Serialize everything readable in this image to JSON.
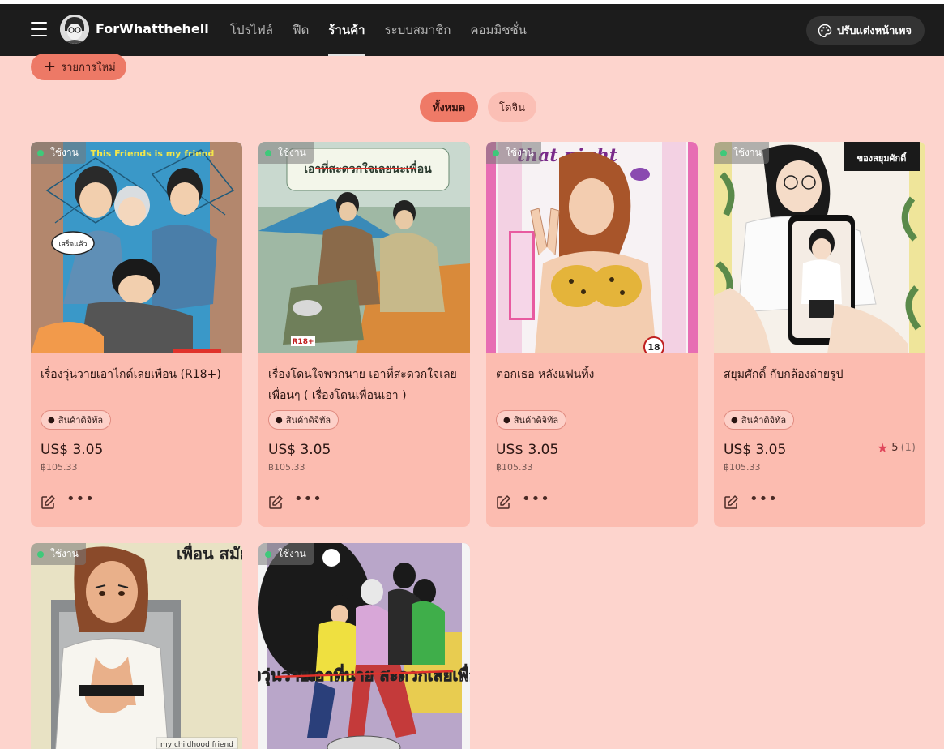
{
  "navbar": {
    "brand": "ForWhatthehell",
    "links": [
      {
        "label": "โปรไฟล์",
        "active": false
      },
      {
        "label": "ฟีด",
        "active": false
      },
      {
        "label": "ร้านค้า",
        "active": true
      },
      {
        "label": "ระบบสมาชิก",
        "active": false
      },
      {
        "label": "คอมมิชชั่น",
        "active": false
      }
    ],
    "customize_label": "ปรับแต่งหน้าเพจ"
  },
  "toolbar": {
    "new_item_label": "รายการใหม่"
  },
  "filters": {
    "all_label": "ทั้งหมด",
    "doujin_label": "โดจิน",
    "active": "all"
  },
  "status_label": "ใช้งาน",
  "tag_label": "สินค้าดิจิทัล",
  "products": [
    {
      "title": "เรื่องวุ่นวายเอาไกด์เลยเพื่อน (R18+)",
      "price_usd": "US$ 3.05",
      "price_thb": "฿105.33",
      "cover_text": "This Friends is my friend",
      "cover_bubble": "เสร็จแล้ว",
      "cover_color": "#3a98c8"
    },
    {
      "title": "เรื่องโดนใจพวกนาย เอาที่สะดวกใจเลยเพื่อนๆ ( เรื่องโดนเพื่อนเอา )",
      "price_usd": "US$ 3.05",
      "price_thb": "฿105.33",
      "cover_text": "เอาที่สะดวกใจเลยนะเพื่อน",
      "cover_sub": "R18+",
      "cover_color": "#7fb08c"
    },
    {
      "title": "ตอกเธอ หลังแฟนทิ้ง",
      "price_usd": "US$ 3.05",
      "price_thb": "฿105.33",
      "cover_text": "that night",
      "cover_sub": "18",
      "cover_color": "#e76db3"
    },
    {
      "title": "สยุมศักดิ์ กับกล้องถ่ายรูป",
      "price_usd": "US$ 3.05",
      "price_thb": "฿105.33",
      "cover_text": "ของสยุมศักดิ์",
      "cover_color": "#efe59a",
      "rating": "5",
      "rating_count": "(1)"
    }
  ],
  "products_row2": [
    {
      "cover_text": "เพื่อน สมัย เด็ก ของผม สุดยอด ไป เลย",
      "cover_sub": "my childhood friend",
      "cover_color": "#e8e2c4"
    },
    {
      "cover_text": "เรื่องวุ่นวายเอาที่นาย สะดวกเลยเพื่อนๆ",
      "cover_color": "#b9a6c9"
    }
  ]
}
